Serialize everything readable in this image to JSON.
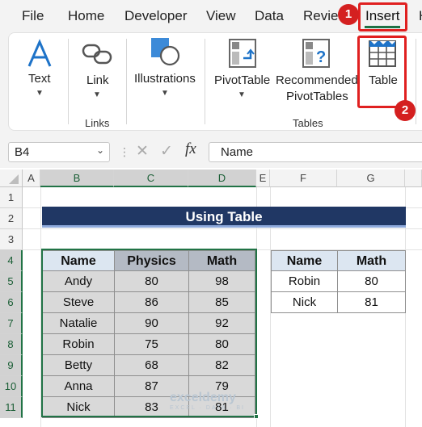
{
  "menu": {
    "tabs": [
      "File",
      "Home",
      "Developer",
      "View",
      "Data",
      "Review",
      "Insert"
    ],
    "partial_tab": "H"
  },
  "ribbon": {
    "text_label": "Text",
    "link_label": "Link",
    "links_group": "Links",
    "illustrations_label": "Illustrations",
    "pivottable_label": "PivotTable",
    "recommended_label_1": "Recommended",
    "recommended_label_2": "PivotTables",
    "table_label": "Table",
    "tables_group": "Tables"
  },
  "callouts": {
    "step1": "1",
    "step2": "2"
  },
  "formula_bar": {
    "name_box": "B4",
    "fx": "fx",
    "formula": "Name"
  },
  "grid": {
    "columns": [
      "A",
      "B",
      "C",
      "D",
      "E",
      "F",
      "G"
    ],
    "rows": [
      "1",
      "2",
      "3",
      "4",
      "5",
      "6",
      "7",
      "8",
      "9",
      "10",
      "11"
    ]
  },
  "banner": "Using Table",
  "main_table": {
    "headers": [
      "Name",
      "Physics",
      "Math"
    ],
    "rows": [
      [
        "Andy",
        "80",
        "98"
      ],
      [
        "Steve",
        "86",
        "85"
      ],
      [
        "Natalie",
        "90",
        "92"
      ],
      [
        "Robin",
        "75",
        "80"
      ],
      [
        "Betty",
        "68",
        "82"
      ],
      [
        "Anna",
        "87",
        "79"
      ],
      [
        "Nick",
        "83",
        "81"
      ]
    ]
  },
  "side_table": {
    "headers": [
      "Name",
      "Math"
    ],
    "rows": [
      [
        "Robin",
        "80"
      ],
      [
        "Nick",
        "81"
      ]
    ]
  },
  "watermark": {
    "name": "exceldemy",
    "tagline": "EXCEL · DATA · BI"
  },
  "colors": {
    "excel_green": "#217346",
    "banner_navy": "#203764",
    "header_fill": "#dce6f1",
    "grey_fill": "#d9d9d9",
    "callout_red": "#d42020"
  }
}
